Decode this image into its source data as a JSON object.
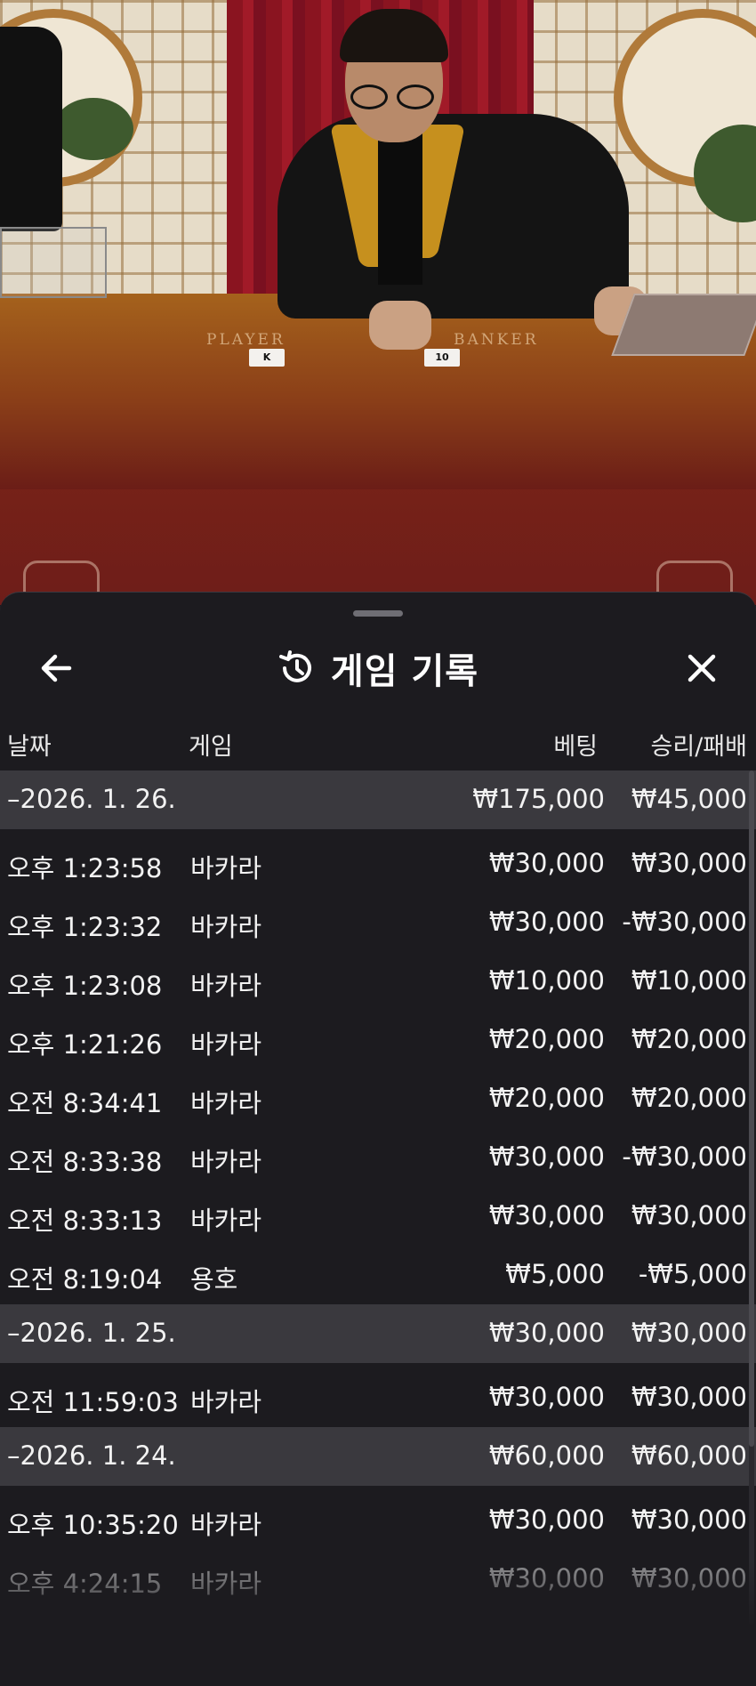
{
  "sheet": {
    "title": "게임 기록",
    "icons": {
      "back": "arrow-left-icon",
      "history": "history-icon",
      "close": "close-icon"
    }
  },
  "video": {
    "table_labels": {
      "player": "PLAYER",
      "banker": "BANKER"
    },
    "cards": {
      "player_card": "K",
      "banker_card": "10"
    }
  },
  "columns": {
    "date": "날짜",
    "game": "게임",
    "bet": "베팅",
    "result": "승리/패배"
  },
  "rows": [
    {
      "kind": "group",
      "date": "–2026. 1. 26.",
      "game": "",
      "bet": "₩175,000",
      "result": "₩45,000"
    },
    {
      "kind": "item",
      "date": "오후 1:23:58",
      "game": "바카라",
      "bet": "₩30,000",
      "result": "₩30,000"
    },
    {
      "kind": "item",
      "date": "오후 1:23:32",
      "game": "바카라",
      "bet": "₩30,000",
      "result": "-₩30,000"
    },
    {
      "kind": "item",
      "date": "오후 1:23:08",
      "game": "바카라",
      "bet": "₩10,000",
      "result": "₩10,000"
    },
    {
      "kind": "item",
      "date": "오후 1:21:26",
      "game": "바카라",
      "bet": "₩20,000",
      "result": "₩20,000"
    },
    {
      "kind": "item",
      "date": "오전 8:34:41",
      "game": "바카라",
      "bet": "₩20,000",
      "result": "₩20,000"
    },
    {
      "kind": "item",
      "date": "오전 8:33:38",
      "game": "바카라",
      "bet": "₩30,000",
      "result": "-₩30,000"
    },
    {
      "kind": "item",
      "date": "오전 8:33:13",
      "game": "바카라",
      "bet": "₩30,000",
      "result": "₩30,000"
    },
    {
      "kind": "item",
      "date": "오전 8:19:04",
      "game": "용호",
      "bet": "₩5,000",
      "result": "-₩5,000"
    },
    {
      "kind": "group",
      "date": "–2026. 1. 25.",
      "game": "",
      "bet": "₩30,000",
      "result": "₩30,000"
    },
    {
      "kind": "item",
      "date": "오전 11:59:03",
      "game": "바카라",
      "bet": "₩30,000",
      "result": "₩30,000"
    },
    {
      "kind": "group",
      "date": "–2026. 1. 24.",
      "game": "",
      "bet": "₩60,000",
      "result": "₩60,000"
    },
    {
      "kind": "item",
      "date": "오후 10:35:20",
      "game": "바카라",
      "bet": "₩30,000",
      "result": "₩30,000"
    },
    {
      "kind": "item",
      "date": "오후 4:24:15",
      "game": "바카라",
      "bet": "₩30,000",
      "result": "₩30,000",
      "faded": true
    }
  ]
}
